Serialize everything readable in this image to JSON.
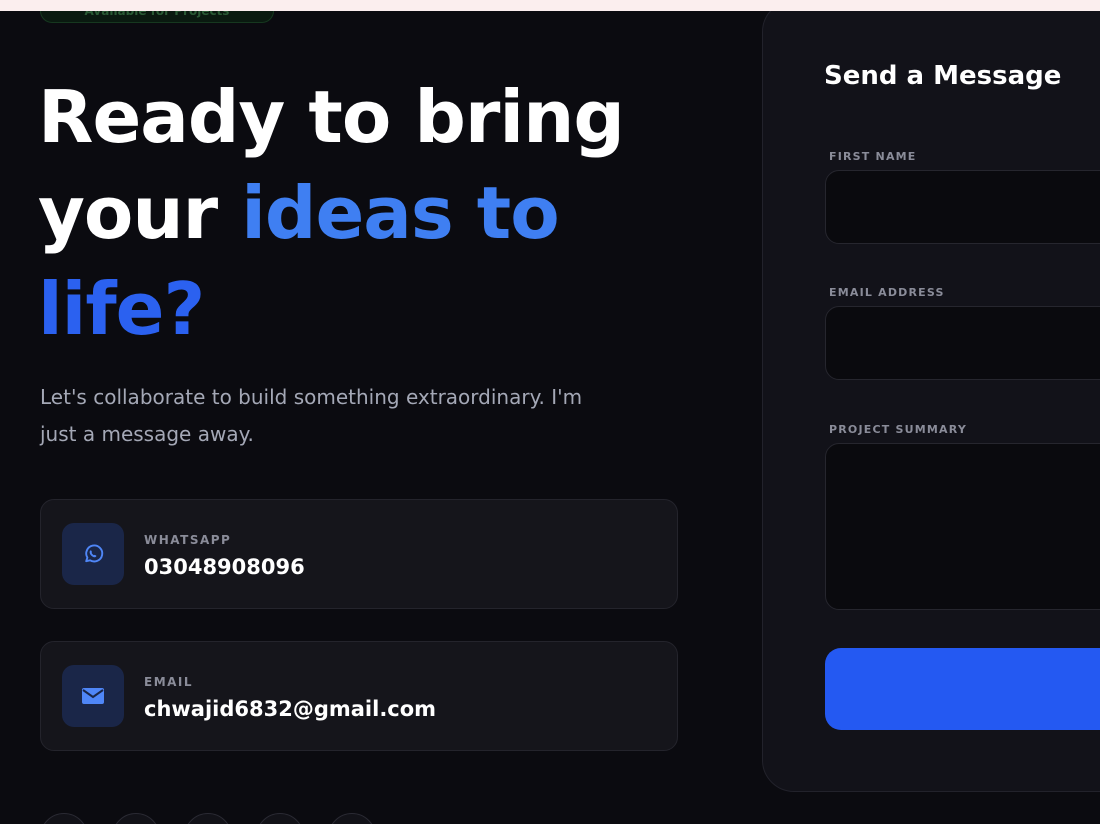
{
  "status_badge": "Available for Projects",
  "hero": {
    "line1": "Ready to bring",
    "line2_start": "your",
    "line2_accent": "ideas to",
    "line3_accent": "life?",
    "subtitle": "Let's collaborate to build something extraordinary. I'm just a message away."
  },
  "contacts": [
    {
      "label": "WHATSAPP",
      "value": "03048908096",
      "icon": "whatsapp-icon"
    },
    {
      "label": "EMAIL",
      "value": "chwajid6832@gmail.com",
      "icon": "mail-icon"
    }
  ],
  "form": {
    "title": "Send a Message",
    "first_name_label": "FIRST NAME",
    "email_label": "EMAIL ADDRESS",
    "summary_label": "PROJECT SUMMARY",
    "submit_label": ""
  },
  "colors": {
    "accent": "#3f7ff2",
    "accent_deep": "#2b61f0",
    "button": "#2459f2",
    "background": "#0b0b10"
  }
}
